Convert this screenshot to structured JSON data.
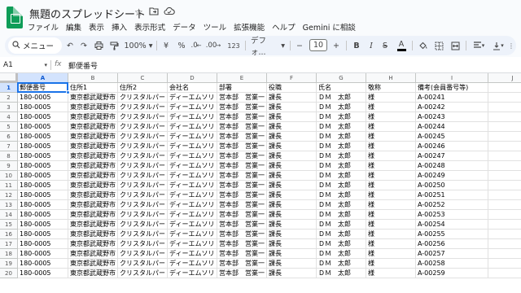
{
  "title": "無題のスプレッドシート",
  "title_icons": [
    "star-icon",
    "move-to-folder-icon",
    "cloud-saved-icon"
  ],
  "menu": [
    "ファイル",
    "編集",
    "表示",
    "挿入",
    "表示形式",
    "データ",
    "ツール",
    "拡張機能",
    "ヘルプ",
    "Gemini に相談"
  ],
  "toolbar": {
    "search_label": "メニュー",
    "zoom": "100%",
    "currency": "¥",
    "percent": "%",
    "decimal_decrease": ".0",
    "decimal_increase": ".00",
    "number_format": "123",
    "font": "デフォ...",
    "font_minus": "−",
    "font_size": "10",
    "font_plus": "+",
    "bold": "B",
    "italic": "I",
    "strike": "S",
    "text_color": "A"
  },
  "formula_bar": {
    "cell_ref": "A1",
    "fx": "fx",
    "value": "郵便番号"
  },
  "columns": [
    "A",
    "B",
    "C",
    "D",
    "E",
    "F",
    "G",
    "H",
    "I",
    "J"
  ],
  "headers": [
    "郵便番号",
    "住所1",
    "住所2",
    "会社名",
    "部署",
    "役職",
    "氏名",
    "敬称",
    "備考(会員番号等)",
    ""
  ],
  "row_numbers": [
    "1",
    "2",
    "3",
    "4",
    "5",
    "6",
    "7",
    "8",
    "9",
    "10",
    "11",
    "12",
    "13",
    "14",
    "15",
    "16",
    "17",
    "18",
    "19",
    "20"
  ],
  "rows": [
    [
      "180-0005",
      "東京都武蔵野市",
      "クリスタルパー",
      "ディーエムソリ",
      "営本部　営業一",
      "課長",
      "ＤＭ　太郎",
      "様",
      "A-00241",
      ""
    ],
    [
      "180-0005",
      "東京都武蔵野市",
      "クリスタルパー",
      "ディーエムソリ",
      "営本部　営業一",
      "課長",
      "ＤＭ　太郎",
      "様",
      "A-00242",
      ""
    ],
    [
      "180-0005",
      "東京都武蔵野市",
      "クリスタルパー",
      "ディーエムソリ",
      "営本部　営業一",
      "課長",
      "ＤＭ　太郎",
      "様",
      "A-00243",
      ""
    ],
    [
      "180-0005",
      "東京都武蔵野市",
      "クリスタルパー",
      "ディーエムソリ",
      "営本部　営業一",
      "課長",
      "ＤＭ　太郎",
      "様",
      "A-00244",
      ""
    ],
    [
      "180-0005",
      "東京都武蔵野市",
      "クリスタルパー",
      "ディーエムソリ",
      "営本部　営業一",
      "課長",
      "ＤＭ　太郎",
      "様",
      "A-00245",
      ""
    ],
    [
      "180-0005",
      "東京都武蔵野市",
      "クリスタルパー",
      "ディーエムソリ",
      "営本部　営業一",
      "課長",
      "ＤＭ　太郎",
      "様",
      "A-00246",
      ""
    ],
    [
      "180-0005",
      "東京都武蔵野市",
      "クリスタルパー",
      "ディーエムソリ",
      "営本部　営業一",
      "課長",
      "ＤＭ　太郎",
      "様",
      "A-00247",
      ""
    ],
    [
      "180-0005",
      "東京都武蔵野市",
      "クリスタルパー",
      "ディーエムソリ",
      "営本部　営業一",
      "課長",
      "ＤＭ　太郎",
      "様",
      "A-00248",
      ""
    ],
    [
      "180-0005",
      "東京都武蔵野市",
      "クリスタルパー",
      "ディーエムソリ",
      "営本部　営業一",
      "課長",
      "ＤＭ　太郎",
      "様",
      "A-00249",
      ""
    ],
    [
      "180-0005",
      "東京都武蔵野市",
      "クリスタルパー",
      "ディーエムソリ",
      "営本部　営業一",
      "課長",
      "ＤＭ　太郎",
      "様",
      "A-00250",
      ""
    ],
    [
      "180-0005",
      "東京都武蔵野市",
      "クリスタルパー",
      "ディーエムソリ",
      "営本部　営業一",
      "課長",
      "ＤＭ　太郎",
      "様",
      "A-00251",
      ""
    ],
    [
      "180-0005",
      "東京都武蔵野市",
      "クリスタルパー",
      "ディーエムソリ",
      "営本部　営業一",
      "課長",
      "ＤＭ　太郎",
      "様",
      "A-00252",
      ""
    ],
    [
      "180-0005",
      "東京都武蔵野市",
      "クリスタルパー",
      "ディーエムソリ",
      "営本部　営業一",
      "課長",
      "ＤＭ　太郎",
      "様",
      "A-00253",
      ""
    ],
    [
      "180-0005",
      "東京都武蔵野市",
      "クリスタルパー",
      "ディーエムソリ",
      "営本部　営業一",
      "課長",
      "ＤＭ　太郎",
      "様",
      "A-00254",
      ""
    ],
    [
      "180-0005",
      "東京都武蔵野市",
      "クリスタルパー",
      "ディーエムソリ",
      "営本部　営業一",
      "課長",
      "ＤＭ　太郎",
      "様",
      "A-00255",
      ""
    ],
    [
      "180-0005",
      "東京都武蔵野市",
      "クリスタルパー",
      "ディーエムソリ",
      "営本部　営業一",
      "課長",
      "ＤＭ　太郎",
      "様",
      "A-00256",
      ""
    ],
    [
      "180-0005",
      "東京都武蔵野市",
      "クリスタルパー",
      "ディーエムソリ",
      "営本部　営業一",
      "課長",
      "ＤＭ　太郎",
      "様",
      "A-00257",
      ""
    ],
    [
      "180-0005",
      "東京都武蔵野市",
      "クリスタルパー",
      "ディーエムソリ",
      "営本部　営業一",
      "課長",
      "ＤＭ　太郎",
      "様",
      "A-00258",
      ""
    ],
    [
      "180-0005",
      "東京都武蔵野市",
      "クリスタルパー",
      "ディーエムソリ",
      "営本部　営業一",
      "課長",
      "ＤＭ　太郎",
      "様",
      "A-00259",
      ""
    ]
  ],
  "colors": {
    "accent": "#1a73e8",
    "logo": "#0f9d58",
    "toolbar_bg": "#edf2fa",
    "selected_header": "#d3e3fd"
  }
}
